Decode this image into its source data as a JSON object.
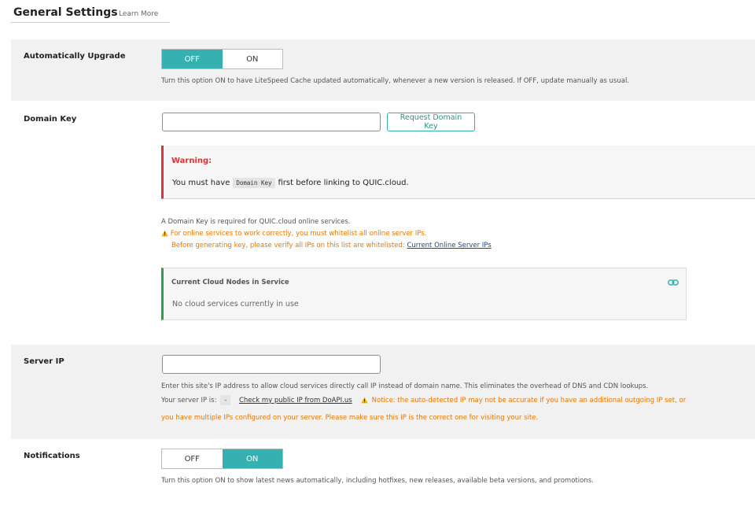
{
  "header": {
    "title": "General Settings",
    "learn_more": "Learn More"
  },
  "auto_upgrade": {
    "label": "Automatically Upgrade",
    "off_label": "OFF",
    "on_label": "ON",
    "state": "OFF",
    "description": "Turn this option ON to have LiteSpeed Cache updated automatically, whenever a new version is released. If OFF, update manually as usual."
  },
  "domain_key": {
    "label": "Domain Key",
    "value": "",
    "button_label": "Request Domain Key",
    "warning": {
      "title": "Warning:",
      "text_before": "You must have",
      "code": "Domain Key",
      "text_after": "first before linking to QUIC.cloud."
    },
    "desc_line1": "A Domain Key is required for QUIC.cloud online services.",
    "desc_line2": "For online services to work correctly, you must whitelist all online server IPs.",
    "desc_line3": "Before generating key, please verify all IPs on this list are whitelisted:",
    "desc_link": "Current Online Server IPs",
    "nodes": {
      "title": "Current Cloud Nodes in Service",
      "text": "No cloud services currently in use"
    }
  },
  "server_ip": {
    "label": "Server IP",
    "value": "",
    "desc_line1": "Enter this site's IP address to allow cloud services directly call IP instead of domain name. This eliminates the overhead of DNS and CDN lookups.",
    "your_ip_label": "Your server IP is:",
    "your_ip_value": "-",
    "check_link": "Check my public IP from DoAPI.us",
    "notice": "Notice: the auto-detected IP may not be accurate if you have an additional outgoing IP set, or",
    "notice_line2": "you have multiple IPs configured on your server. Please make sure this IP is the correct one for visiting your site."
  },
  "notifications": {
    "label": "Notifications",
    "off_label": "OFF",
    "on_label": "ON",
    "state": "ON",
    "description": "Turn this option ON to show latest news automatically, including hotfixes, new releases, available beta versions, and promotions."
  },
  "colors": {
    "accent": "#36b0b0",
    "warning": "#d63638",
    "notice": "#e67700",
    "success": "#2e9e4a"
  }
}
